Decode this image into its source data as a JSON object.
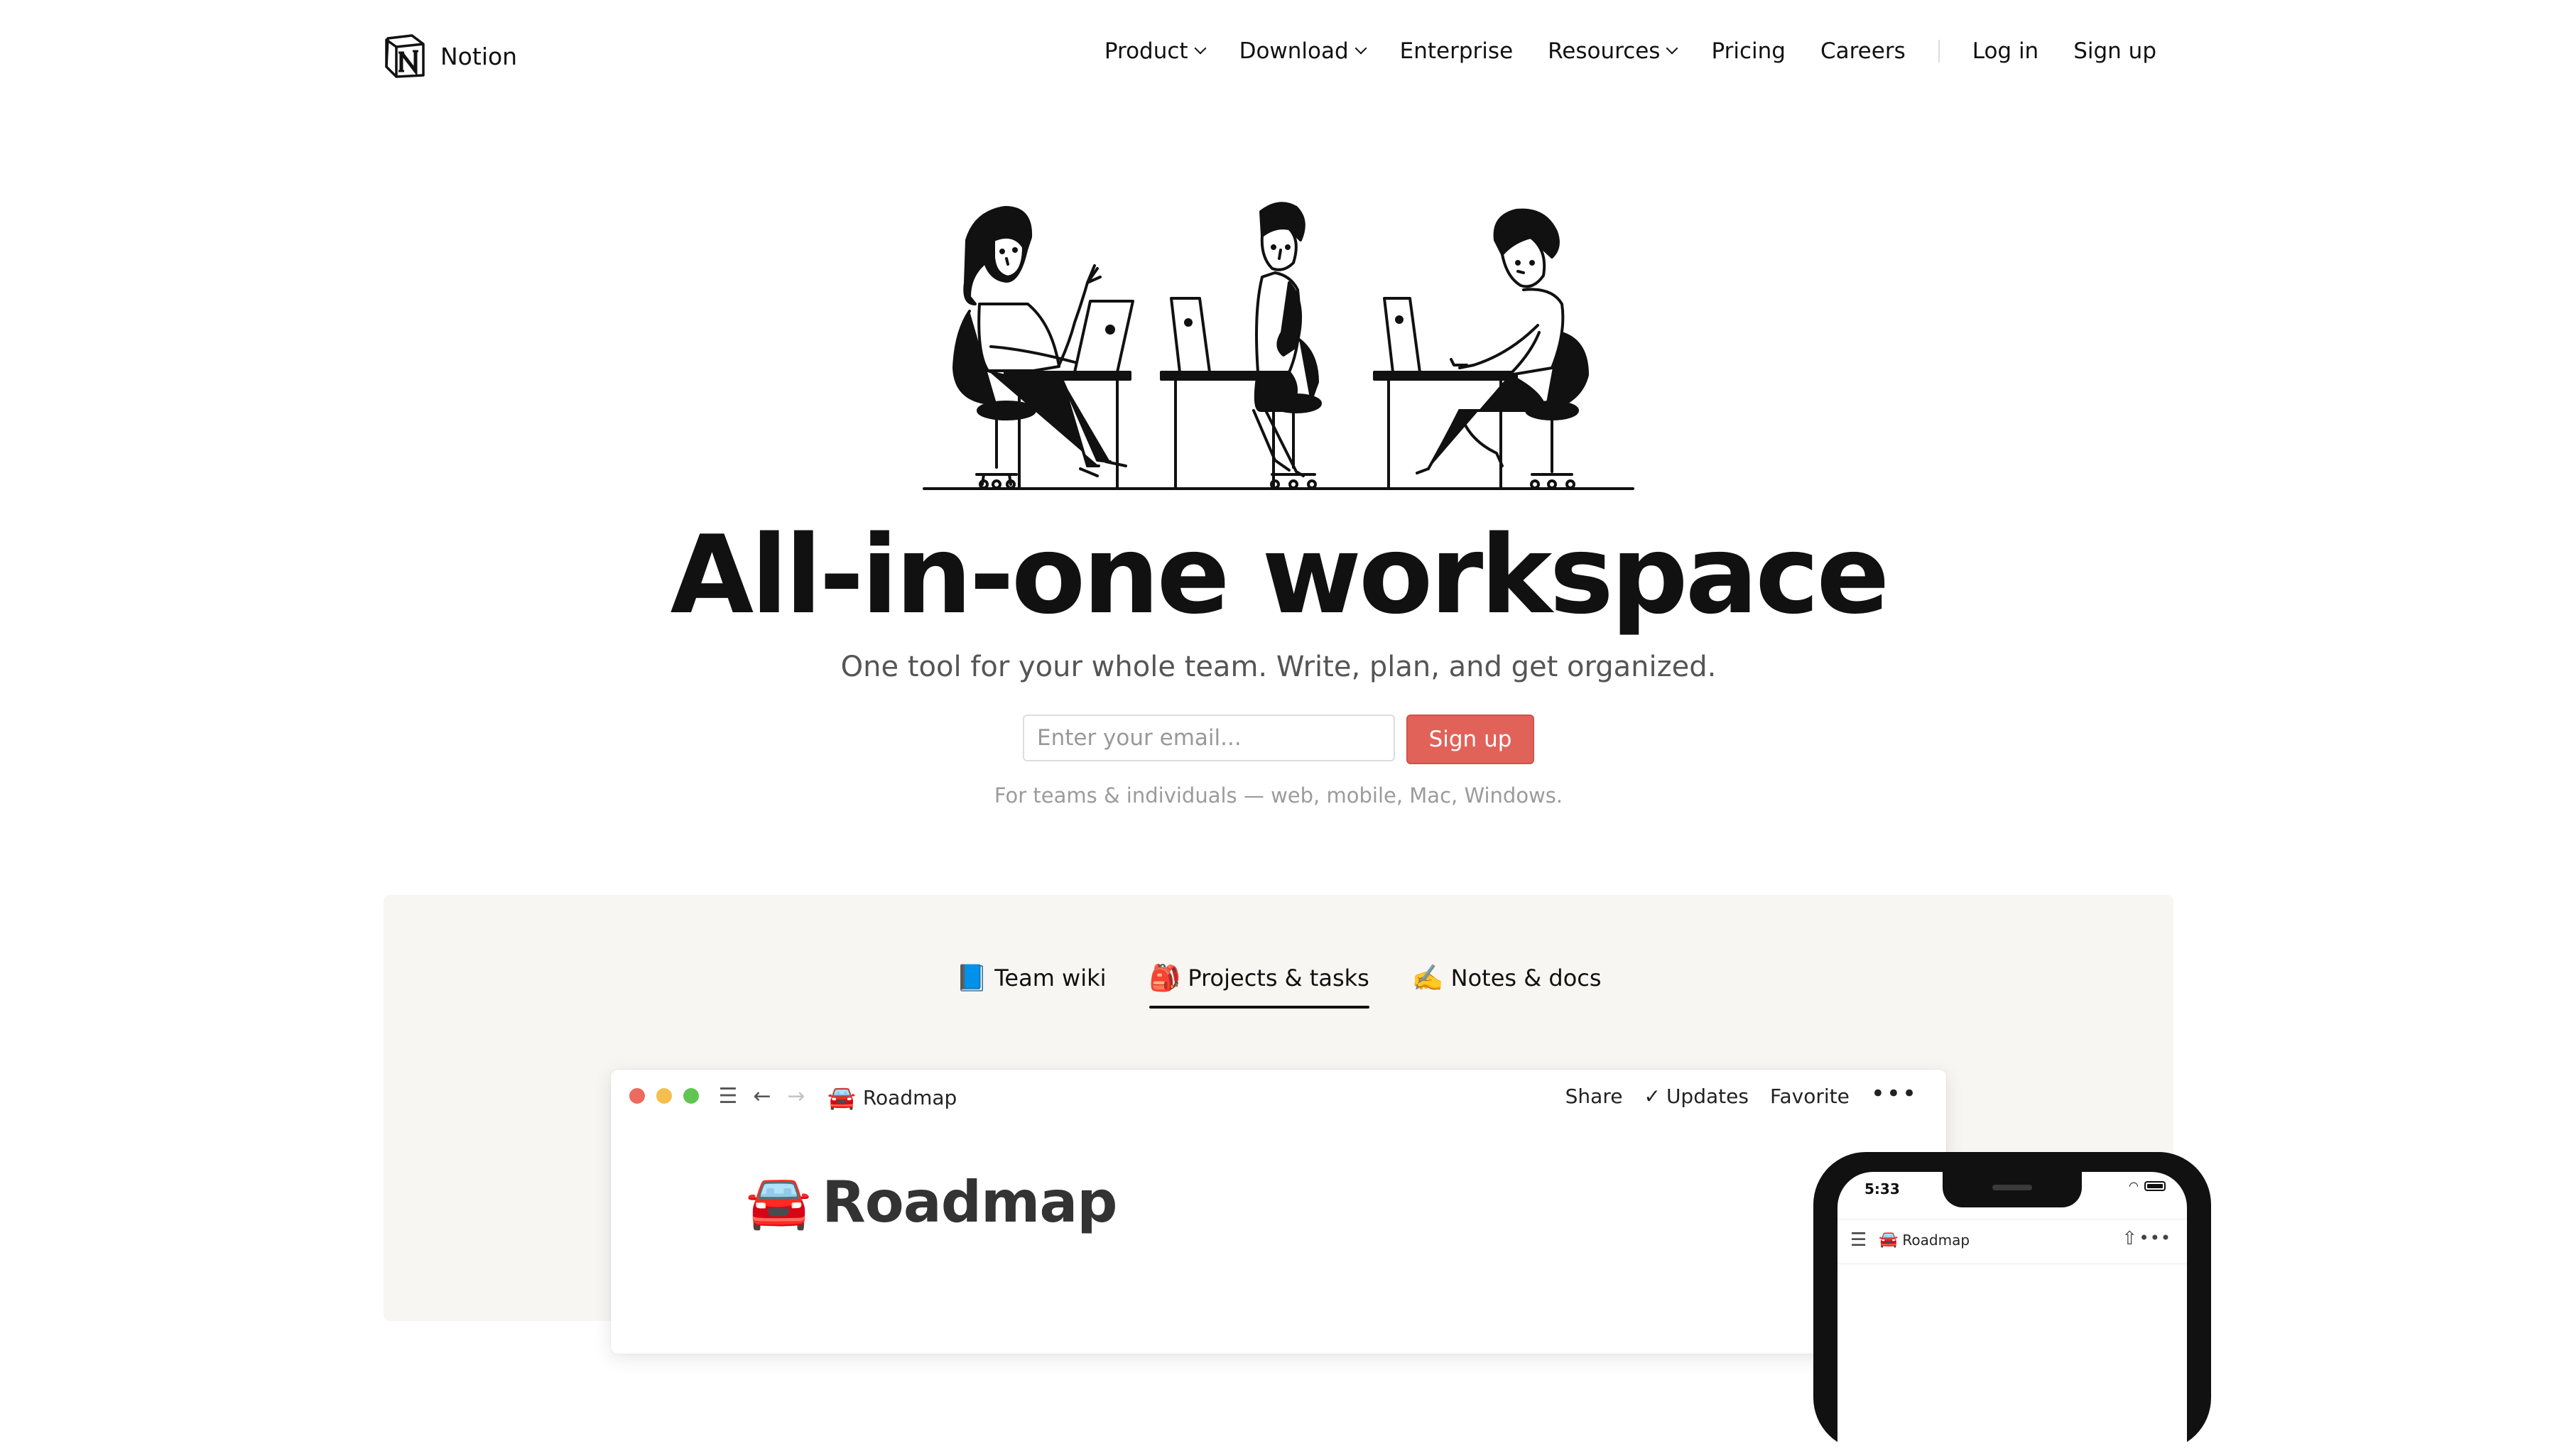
{
  "nav": {
    "brand": "Notion",
    "items": [
      {
        "label": "Product",
        "dropdown": true
      },
      {
        "label": "Download",
        "dropdown": true
      },
      {
        "label": "Enterprise",
        "dropdown": false
      },
      {
        "label": "Resources",
        "dropdown": true
      },
      {
        "label": "Pricing",
        "dropdown": false
      },
      {
        "label": "Careers",
        "dropdown": false
      }
    ],
    "login": "Log in",
    "signup": "Sign up"
  },
  "hero": {
    "title": "All-in-one workspace",
    "subtitle": "One tool for your whole team. Write, plan, and get organized.",
    "email_placeholder": "Enter your email...",
    "signup_button": "Sign up",
    "note": "For teams & individuals — web, mobile, Mac, Windows."
  },
  "showcase": {
    "tabs": [
      {
        "emoji": "📘",
        "label": "Team wiki",
        "active": false
      },
      {
        "emoji": "🎒",
        "label": "Projects & tasks",
        "active": true
      },
      {
        "emoji": "✍️",
        "label": "Notes & docs",
        "active": false
      }
    ],
    "window": {
      "breadcrumb_emoji": "🚘",
      "breadcrumb": "Roadmap",
      "actions": {
        "share": "Share",
        "updates": "Updates",
        "favorite": "Favorite",
        "more": "•••"
      },
      "page_emoji": "🚘",
      "page_title": "Roadmap"
    },
    "phone": {
      "time": "5:33",
      "breadcrumb_emoji": "🚘",
      "breadcrumb": "Roadmap"
    }
  },
  "colors": {
    "accent": "#e16259",
    "showcase_bg": "#f7f6f3",
    "text": "#111111",
    "muted": "#9b9b9b"
  },
  "icons": [
    "notion-logo",
    "chevron-down-icon",
    "hamburger-icon",
    "back-arrow-icon",
    "forward-arrow-icon",
    "check-icon",
    "more-icon",
    "wifi-icon",
    "battery-icon",
    "share-icon"
  ]
}
